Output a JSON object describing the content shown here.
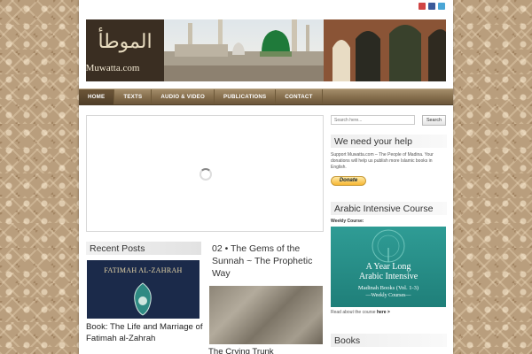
{
  "site": {
    "logo_text": "Muwatta.com"
  },
  "nav": {
    "items": [
      "HOME",
      "TEXTS",
      "AUDIO & VIDEO",
      "PUBLICATIONS",
      "CONTACT"
    ]
  },
  "main": {
    "recent_posts_title": "Recent Posts",
    "post1": {
      "title": "Book: The Life and Marriage of Fatimah al-Zahrah",
      "image_text": "FATIMAH AL-ZAHRAH"
    },
    "post2": {
      "title": "02 • The Gems of the Sunnah ~ The Prophetic Way"
    },
    "post3": {
      "title": "The Crying Trunk"
    }
  },
  "sidebar": {
    "search": {
      "placeholder": "Search here...",
      "button": "Search"
    },
    "help_title": "We need your help",
    "help_text": "Support Muwatta.com – The People of Madina. Your donations will help us publish more Islamic books in English.",
    "donate_label": "Donate",
    "arabic_title": "Arabic Intensive Course",
    "weekly_label": "Weekly Course:",
    "arabic_box": {
      "line1": "A Year Long",
      "line2": "Arabic Intensive",
      "line3": "Madinah Books (Vol. 1-3)",
      "line4": "—Weekly Courses—"
    },
    "read_more_prefix": "Read about the course",
    "read_more_link": "here >",
    "books_title": "Books"
  },
  "colors": {
    "nav": "#836c4b",
    "teal": "#1f7f79",
    "navy": "#1b2a4a"
  },
  "icons": [
    "youtube-icon",
    "facebook-icon",
    "twitter-icon",
    "loading-spinner-icon"
  ]
}
